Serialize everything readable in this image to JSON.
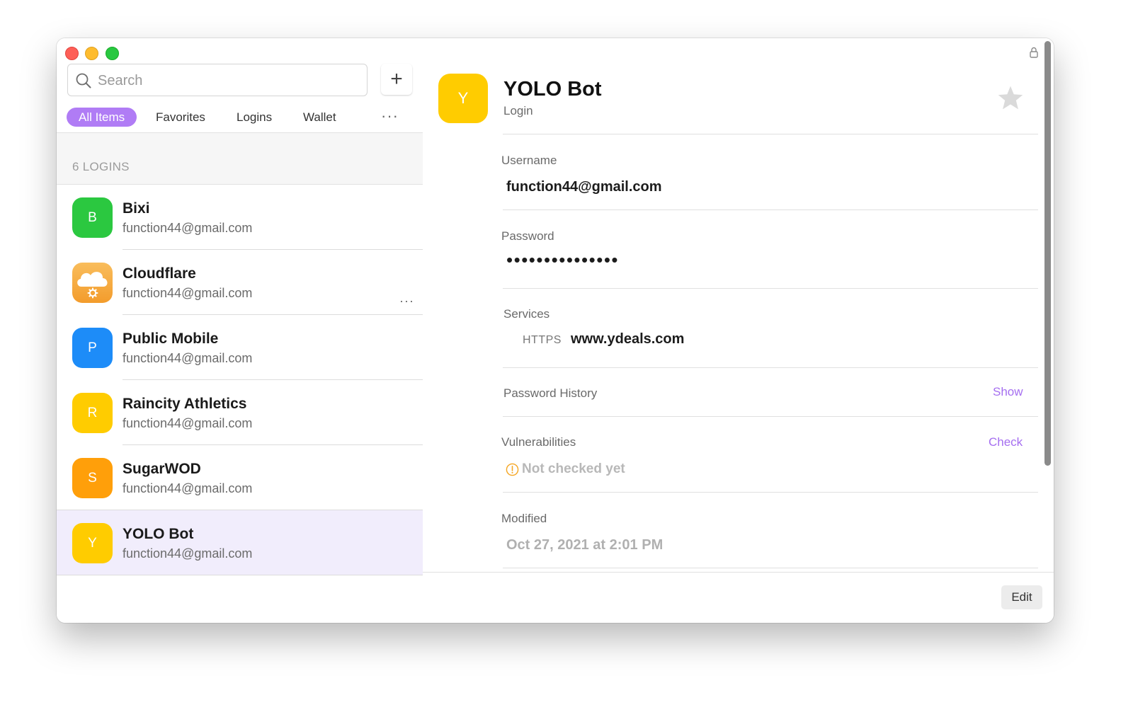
{
  "window": {
    "controls": [
      "close",
      "minimize",
      "zoom"
    ]
  },
  "sidebar": {
    "search": {
      "placeholder": "Search",
      "value": ""
    },
    "add_label": "+",
    "filters": [
      {
        "label": "All Items",
        "active": true
      },
      {
        "label": "Favorites",
        "active": false
      },
      {
        "label": "Logins",
        "active": false
      },
      {
        "label": "Wallet",
        "active": false
      }
    ],
    "filters_more": "···",
    "section_title": "6 LOGINS",
    "items": [
      {
        "name": "Bixi",
        "username": "function44@gmail.com",
        "initial": "B",
        "icon_color": "#2bc840"
      },
      {
        "name": "Cloudflare",
        "username": "function44@gmail.com",
        "initial": "",
        "icon_color": "#f5a53a",
        "icon": "cloud-gear-icon",
        "more": "···"
      },
      {
        "name": "Public Mobile",
        "username": "function44@gmail.com",
        "initial": "P",
        "icon_color": "#1d8cf8"
      },
      {
        "name": "Raincity Athletics",
        "username": "function44@gmail.com",
        "initial": "R",
        "icon_color": "#ffcc00"
      },
      {
        "name": "SugarWOD",
        "username": "function44@gmail.com",
        "initial": "S",
        "icon_color": "#ff9f0a"
      },
      {
        "name": "YOLO Bot",
        "username": "function44@gmail.com",
        "initial": "Y",
        "icon_color": "#ffcc00",
        "selected": true
      }
    ]
  },
  "detail": {
    "title": "YOLO Bot",
    "type": "Login",
    "initial": "Y",
    "icon_color": "#ffcc00",
    "username_label": "Username",
    "username": "function44@gmail.com",
    "password_label": "Password",
    "password_mask": "•••••••••••••••",
    "services_label": "Services",
    "service_scheme": "HTTPS",
    "service_url": "www.ydeals.com",
    "password_history_label": "Password History",
    "password_history_action": "Show",
    "vulnerabilities_label": "Vulnerabilities",
    "vulnerabilities_action": "Check",
    "vulnerabilities_status": "Not checked yet",
    "modified_label": "Modified",
    "modified_value": "Oct 27, 2021 at 2:01 PM",
    "edit_label": "Edit"
  },
  "colors": {
    "accent": "#b07cf5",
    "link": "#a56ef0",
    "selected_row": "#f1edfc",
    "warning": "#f5a623"
  }
}
